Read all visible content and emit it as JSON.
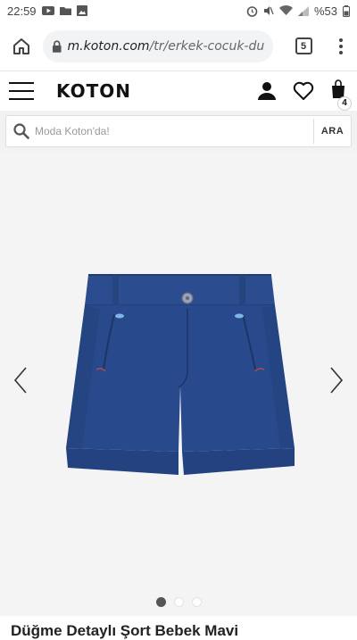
{
  "status_bar": {
    "time": "22:59",
    "battery": "%53"
  },
  "browser": {
    "url_domain": "m.koton.com",
    "url_path": "/tr/erkek-cocuk-dug",
    "tabs_count": "5"
  },
  "site": {
    "logo": "KOTON",
    "cart_count": "4"
  },
  "search": {
    "placeholder": "Moda Koton'da!",
    "button_label": "ARA"
  },
  "gallery": {
    "image_count": 3,
    "active_index": 0
  },
  "product": {
    "title": "Düğme Detaylı Şort Bebek Mavi"
  },
  "colors": {
    "shorts_blue": "#284a8c",
    "shorts_dark": "#1e3a72",
    "gallery_bg": "#f4f4f4"
  }
}
